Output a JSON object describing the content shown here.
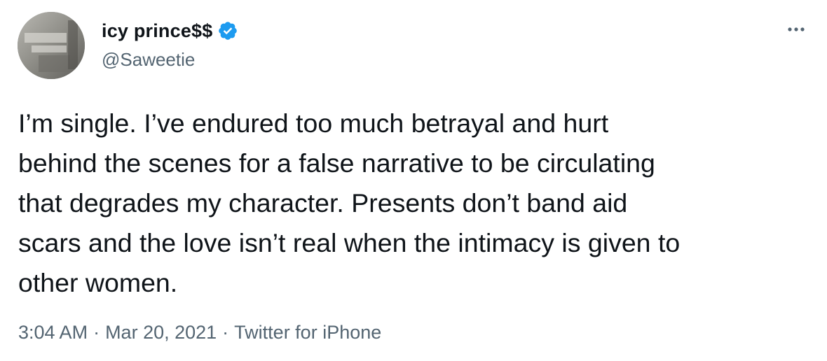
{
  "author": {
    "display_name": "icy prince$$",
    "handle": "@Saweetie",
    "verified": true,
    "avatar_icon": "profile-photo"
  },
  "tweet": {
    "text_lines": [
      "I’m single. I’ve endured too much betrayal and hurt",
      "behind the scenes for a false narrative to be circulating",
      "that degrades my character. Presents don’t band aid",
      "scars and the love isn’t real when the intimacy is given to",
      "other women."
    ]
  },
  "meta": {
    "time": "3:04 AM",
    "separator": "·",
    "date": "Mar 20, 2021",
    "source": "Twitter for iPhone"
  },
  "icons": {
    "verified": "verified-badge-icon",
    "more": "more-options-icon"
  },
  "colors": {
    "verified_blue": "#1d9bf0",
    "secondary_text": "#536471",
    "primary_text": "#0f1419"
  }
}
